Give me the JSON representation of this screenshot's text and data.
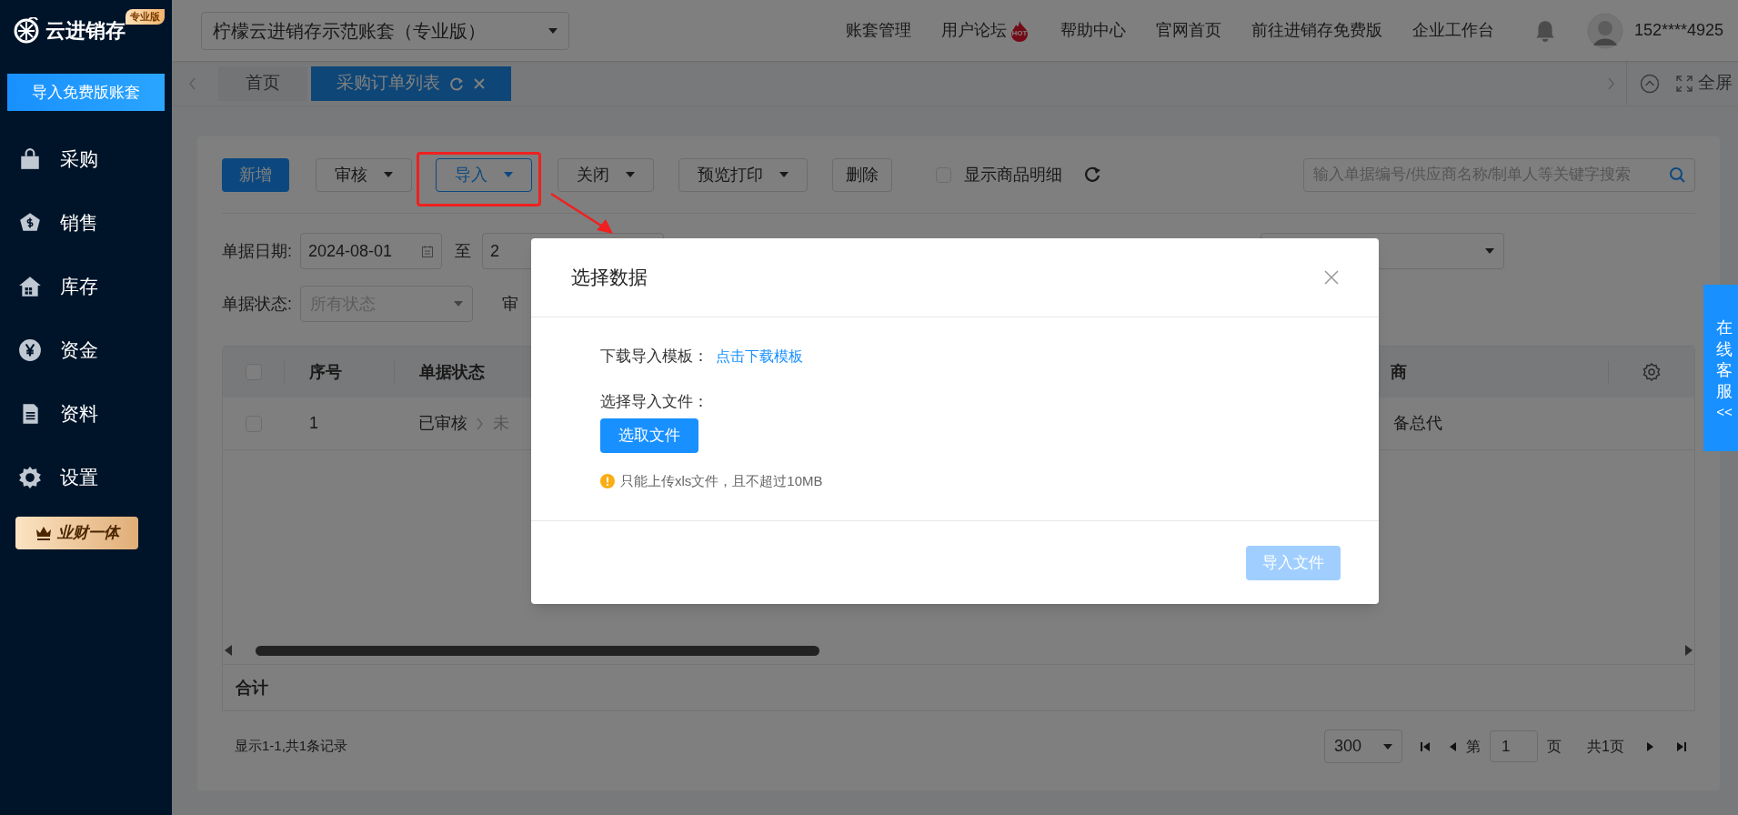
{
  "sidebar": {
    "logo": "云进销存",
    "edition_badge": "专业版",
    "import_button": "导入免费版账套",
    "items": [
      {
        "label": "采购",
        "kind": "bag"
      },
      {
        "label": "销售",
        "kind": "dollar"
      },
      {
        "label": "库存",
        "kind": "house"
      },
      {
        "label": "资金",
        "kind": "yen"
      },
      {
        "label": "资料",
        "kind": "doc"
      },
      {
        "label": "设置",
        "kind": "gear"
      }
    ],
    "promo_badge": "业财一体"
  },
  "header": {
    "account_select": "柠檬云进销存示范账套（专业版）",
    "links": [
      {
        "label": "账套管理"
      },
      {
        "label": "用户论坛",
        "badge": "HOT"
      },
      {
        "label": "帮助中心"
      },
      {
        "label": "官网首页"
      },
      {
        "label": "前往进销存免费版"
      },
      {
        "label": "企业工作台"
      }
    ],
    "user": "152****4925"
  },
  "tabs": [
    {
      "label": "首页",
      "selected": false
    },
    {
      "label": "采购订单列表",
      "selected": true
    }
  ],
  "fullscreen": "全屏",
  "toolbar": {
    "buttons": [
      {
        "label": "新增",
        "kind": "primary",
        "highlighted": false
      },
      {
        "label": "审核",
        "kind": "dropdown",
        "highlighted": false
      },
      {
        "label": "导入",
        "kind": "dropdown",
        "highlighted": true
      },
      {
        "label": "关闭",
        "kind": "dropdown",
        "highlighted": false
      },
      {
        "label": "预览打印",
        "kind": "dropdown",
        "highlighted": false
      },
      {
        "label": "删除",
        "kind": "plain",
        "highlighted": false
      }
    ],
    "show_details": {
      "label": "显示商品明细",
      "checked": false
    },
    "search": {
      "placeholder": "输入单据编号/供应商名称/制单人等关键字搜索"
    }
  },
  "filters": {
    "date_label": "单据日期:",
    "date_from": "2024-08-01",
    "to_label": "至",
    "date_to": "2",
    "status_label": "单据状态:",
    "status_placeholder": "所有状态",
    "audit_label": "审"
  },
  "table": {
    "all_checked": false,
    "columns": [
      "序号",
      "单据状态",
      "商"
    ],
    "rows": [
      {
        "checked": false,
        "index": "1",
        "status": "已审核",
        "status_next": "未",
        "column_3": "备总代"
      }
    ],
    "total_label": "合计"
  },
  "pagination": {
    "summary": "显示1-1,共1条记录",
    "page_size": "300",
    "page_label": "第",
    "page": "1",
    "page_unit": "页",
    "total_pages": "共1页"
  },
  "modal": {
    "title": "选择数据",
    "template_label": "下载导入模板：",
    "template_link": "点击下载模板",
    "file_label": "选择导入文件：",
    "choose_button": "选取文件",
    "hint": "只能上传xls文件，且不超过10MB",
    "submit_button": {
      "label": "导入文件",
      "disabled": true
    }
  },
  "support": {
    "label": "在线客服",
    "arrows": "<<"
  }
}
